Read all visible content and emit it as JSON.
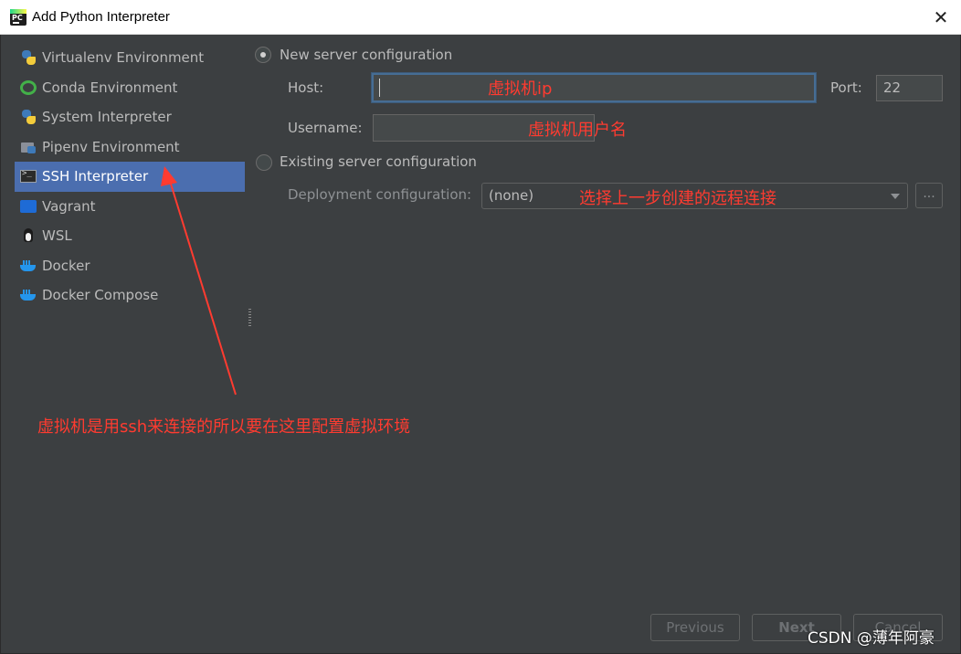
{
  "window": {
    "title": "Add Python Interpreter",
    "app_icon_text": "PC",
    "close_glyph": "✕"
  },
  "sidebar": {
    "items": [
      {
        "label": "Virtualenv Environment",
        "icon": "python-icon"
      },
      {
        "label": "Conda Environment",
        "icon": "conda-icon"
      },
      {
        "label": "System Interpreter",
        "icon": "python-icon"
      },
      {
        "label": "Pipenv Environment",
        "icon": "folder-python-icon"
      },
      {
        "label": "SSH Interpreter",
        "icon": "terminal-icon",
        "selected": true
      },
      {
        "label": "Vagrant",
        "icon": "vagrant-icon"
      },
      {
        "label": "WSL",
        "icon": "linux-icon"
      },
      {
        "label": "Docker",
        "icon": "docker-icon"
      },
      {
        "label": "Docker Compose",
        "icon": "docker-icon"
      }
    ]
  },
  "form": {
    "new_server_label": "New server configuration",
    "new_server_selected": true,
    "host_label": "Host:",
    "host_value": "",
    "port_label": "Port:",
    "port_value": "22",
    "username_label": "Username:",
    "username_value": "",
    "existing_server_label": "Existing server configuration",
    "existing_server_selected": false,
    "deployment_label": "Deployment configuration:",
    "deployment_value": "(none)",
    "browse_label": "..."
  },
  "annotations": {
    "host_note": "虚拟机ip",
    "username_note": "虚拟机用户名",
    "deployment_note": "选择上一步创建的远程连接",
    "ssh_note": "虚拟机是用ssh来连接的所以要在这里配置虚拟环境",
    "color": "#ff3b30"
  },
  "footer": {
    "previous_label": "Previous",
    "next_label": "Next",
    "cancel_label": "Cancel"
  },
  "watermark": "CSDN @薄年阿豪",
  "colors": {
    "background": "#3c3f41",
    "selection": "#4b6eaf",
    "focus_border": "#466d94"
  }
}
